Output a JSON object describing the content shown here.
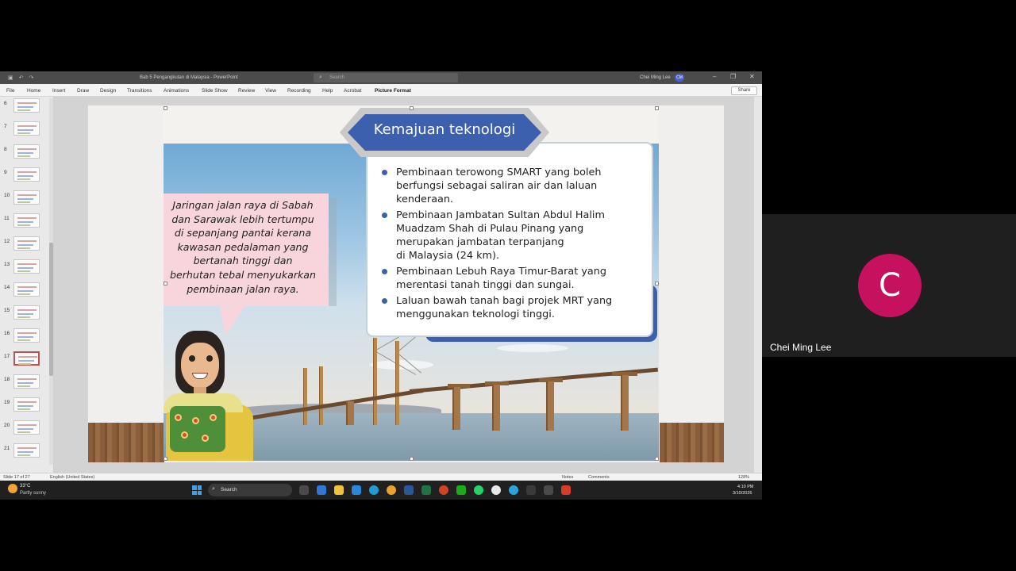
{
  "window": {
    "doc_title": "Bab 5 Pengangkutan di Malaysia  -  PowerPoint",
    "search_placeholder": "Search",
    "user_name": "Chei Ming Lee",
    "user_initials": "CM",
    "qat_icons": [
      "save-icon",
      "undo-icon",
      "redo-icon"
    ],
    "controls": [
      "minimize-icon",
      "restore-icon",
      "close-icon"
    ]
  },
  "menu": {
    "tabs": [
      "File",
      "Home",
      "Insert",
      "Draw",
      "Design",
      "Transitions",
      "Animations",
      "Slide Show",
      "Review",
      "View",
      "Recording",
      "Help",
      "Acrobat",
      "Picture Format"
    ],
    "share_label": "Share"
  },
  "thumbnails": {
    "numbers": [
      "6",
      "7",
      "8",
      "9",
      "10",
      "11",
      "12",
      "13",
      "14",
      "15",
      "16",
      "17",
      "18",
      "19",
      "20",
      "21"
    ],
    "active": "17"
  },
  "slide": {
    "title": "Kemajuan teknologi",
    "speech": [
      "Jaringan jalan raya di Sabah",
      "dan Sarawak lebih tertumpu",
      "di sepanjang pantai kerana",
      "kawasan pedalaman yang",
      "bertanah tinggi dan",
      "berhutan tebal menyukarkan",
      "pembinaan jalan raya."
    ],
    "bullets": [
      [
        "Pembinaan terowong SMART yang boleh",
        "berfungsi sebagai saliran air dan laluan",
        "kenderaan."
      ],
      [
        "Pembinaan Jambatan Sultan Abdul Halim",
        "Muadzam Shah di Pulau Pinang yang",
        "merupakan jambatan terpanjang",
        "di Malaysia (24 km)."
      ],
      [
        "Pembinaan Lebuh Raya Timur-Barat yang",
        "merentasi tanah tinggi dan sungai."
      ],
      [
        "Laluan bawah tanah bagi projek MRT yang",
        "menggunakan teknologi tinggi."
      ]
    ]
  },
  "status": {
    "slide_info": "Slide 17 of 27",
    "language": "English (United States)",
    "notes": "Notes",
    "comments": "Comments",
    "zoom": "128%"
  },
  "taskbar": {
    "weather_temp": "33°C",
    "weather_desc": "Partly sunny",
    "search_label": "Search",
    "time": "4:10 PM",
    "date": "3/10/2026"
  },
  "participant": {
    "initial": "C",
    "name": "Chei Ming Lee",
    "avatar_color": "#c6115f"
  }
}
